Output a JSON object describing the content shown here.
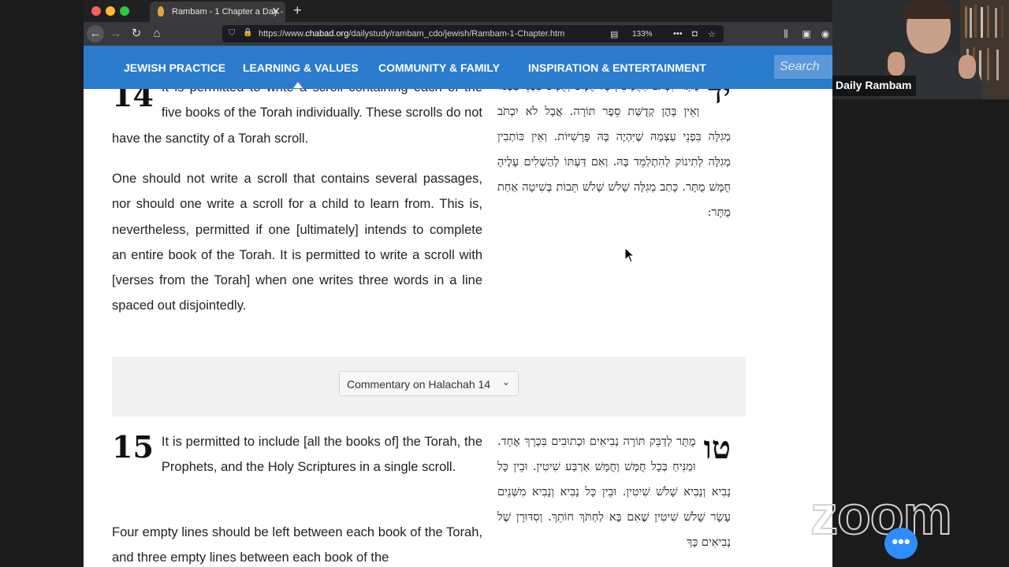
{
  "browser": {
    "tab_title": "Rambam - 1 Chapter a Day - Da",
    "url_prefix": "https://www.",
    "url_domain": "chabad.org",
    "url_path": "/dailystudy/rambam_cdo/jewish/Rambam-1-Chapter.htm",
    "zoom": "133%"
  },
  "site_nav": {
    "items": [
      "JEWISH PRACTICE",
      "LEARNING & VALUES",
      "COMMUNITY & FAMILY",
      "INSPIRATION & ENTERTAINMENT"
    ],
    "search_placeholder": "Search"
  },
  "halachot": [
    {
      "number": "14",
      "english_lead": "It is permitted to write a scroll containing each of the five books of the Torah individually. These scrolls do not have the sanctity of a Torah scroll.",
      "english_second": "One should not write a scroll that contains several passages, nor should one write a scroll for a child to learn from. This is, nevertheless, permitted if one [ultimately] intends to complete an entire book of the Torah. It is permitted to write a scroll with [verses from the Torah] when one writes three words in a line spaced out disjointedly.",
      "hebrew_number": "יד",
      "hebrew": "מֻתָּר לִכְתֹּב הַחֻמָּשִׁין כָּל חֻמָּשׁ וְחֻמָּשׁ בִּפְנֵי עַצְמוֹ וְאֵין בָּהֶן קְדֻשַּׁת סֵפֶר תּוֹרָה. אֲבָל לֹא יִכְתֹּב מְגִלָּה בִּפְנֵי עַצְמָהּ שֶׁיִּהְיֶה בָּהּ פָּרָשִׁיּוֹת. וְאֵין כּוֹתְבִין מְגִלָּה לְתִינוֹק לְהִתְלַמֵּד בָּהּ. וְאִם דַּעְתּוֹ לְהַשְׁלִים עָלֶיהָ חֻמָּשׁ מֻתָּר. כָּתַב מְגִלָּה שָׁלֹשׁ שָׁלֹשׁ תֵּבוֹת בְּשִׁיטָה אַחַת מֻתָּר:"
    },
    {
      "number": "15",
      "english_lead": "It is permitted to include [all the books of] the Torah, the Prophets, and the Holy Scriptures in a single scroll.",
      "english_second": "Four empty lines should be left between each book of the Torah, and three empty lines between each book of the",
      "hebrew_number": "טו",
      "hebrew": "מֻתָּר לְדַבֵּק תּוֹרָה נְבִיאִים וּכְתוּבִים בִּכְרָךְ אֶחָד. וּמַנִּיחַ בְּכָל חֻמָּשׁ וְחֻמָּשׁ אַרְבַּע שִׁיטִין. וּבֵין כָּל נָבִיא וְנָבִיא שָׁלֹשׁ שִׁיטִין. וּבֵין כָּל נָבִיא וְנָבִיא מִשְּׁנֵים עָשָׂר שָׁלֹשׁ שִׁיטִין שֶׁאִם בָּא לַחְתֹּךְ חוֹתֵךְ. וְסִדּוּרָן שֶׁל נְבִיאִים כָּךְ"
    }
  ],
  "commentary": {
    "label": "Commentary on Halachah 14"
  },
  "zoom_meeting": {
    "participant_name": "Daily Rambam",
    "logo_text": "zoom"
  }
}
